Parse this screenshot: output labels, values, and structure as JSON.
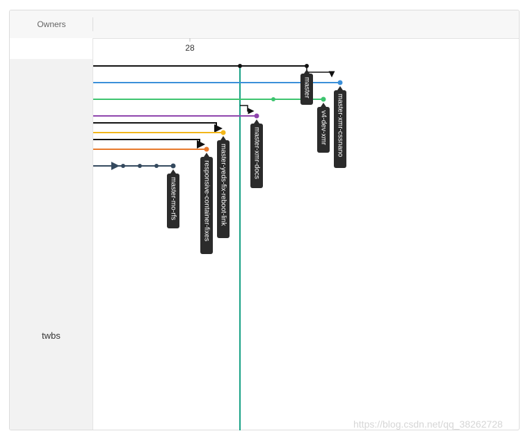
{
  "header": {
    "owners_label": "Owners"
  },
  "owner": {
    "name": "twbs"
  },
  "timeline": {
    "tick_label": "28"
  },
  "watermark": "https://blog.csdn.net/qq_38262728",
  "colors": {
    "black": "#111111",
    "blue": "#3a8fd9",
    "green": "#3cc46e",
    "purple": "#8e44ad",
    "yellow": "#f2b619",
    "orange": "#e8782a",
    "navy": "#34495e",
    "teal": "#16a085",
    "tag": "#2b2b2b"
  },
  "branches": [
    {
      "label": "master",
      "color": "black"
    },
    {
      "label": "master-xmr-cssnano",
      "color": "blue"
    },
    {
      "label": "v4-dev-xmr",
      "color": "green"
    },
    {
      "label": "master-xmr-docs",
      "color": "purple"
    },
    {
      "label": "master-yeds-fix-reboot-link",
      "color": "yellow"
    },
    {
      "label": "responsive-container-fixes",
      "color": "orange"
    },
    {
      "label": "master-mo-rfs",
      "color": "navy"
    }
  ]
}
